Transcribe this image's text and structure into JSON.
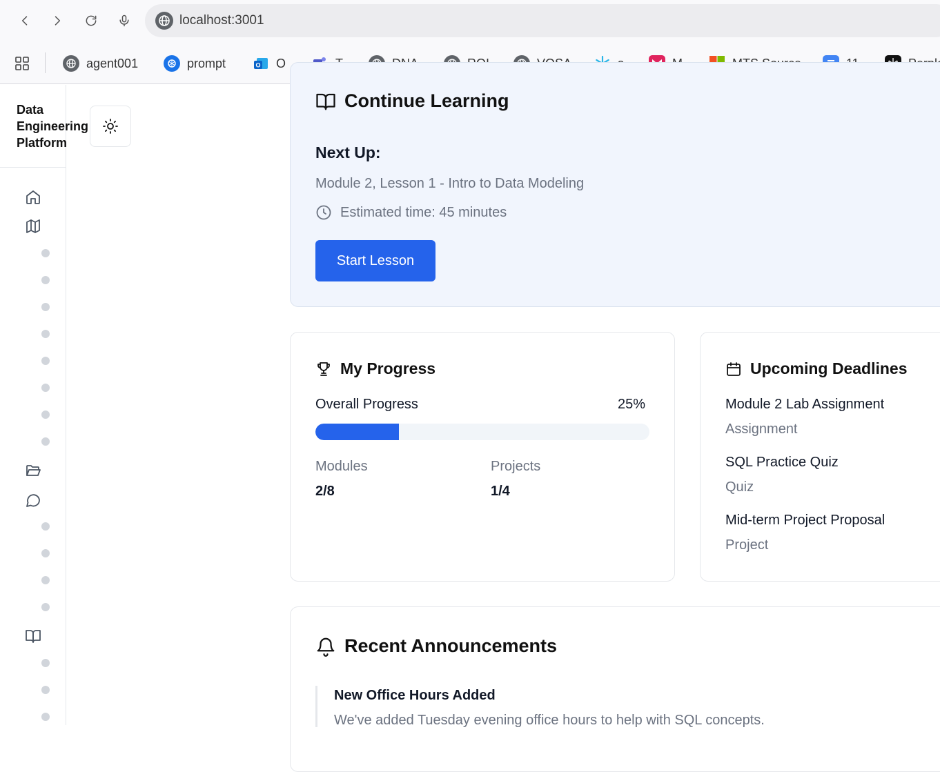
{
  "browser": {
    "url": "localhost:3001",
    "bookmarks": [
      {
        "label": "agent001",
        "icon": "globe-icon"
      },
      {
        "label": "prompt",
        "icon": "openai-icon"
      },
      {
        "label": "O",
        "icon": "outlook-icon"
      },
      {
        "label": "T",
        "icon": "teams-icon"
      },
      {
        "label": "DNA",
        "icon": "globe-icon"
      },
      {
        "label": "ROI",
        "icon": "globe-icon"
      },
      {
        "label": "VOSA",
        "icon": "globe-icon"
      },
      {
        "label": "s",
        "icon": "snowflake-icon"
      },
      {
        "label": "M",
        "icon": "m-logo-icon"
      },
      {
        "label": "MTS Source",
        "icon": "microsoft-icon"
      },
      {
        "label": "11",
        "icon": "docs-icon"
      },
      {
        "label": "Perple",
        "icon": "perplexity-icon"
      }
    ]
  },
  "sidebar": {
    "brand": "Data Engineering Platform"
  },
  "continue_learning": {
    "title": "Continue Learning",
    "next_up_label": "Next Up:",
    "lesson": "Module 2, Lesson 1 - Intro to Data Modeling",
    "estimated": "Estimated time: 45 minutes",
    "button": "Start Lesson"
  },
  "progress": {
    "title": "My Progress",
    "overall_label": "Overall Progress",
    "overall_value": "25%",
    "overall_fraction": 0.25,
    "modules_label": "Modules",
    "modules_value": "2/8",
    "projects_label": "Projects",
    "projects_value": "1/4"
  },
  "deadlines": {
    "title": "Upcoming Deadlines",
    "items": [
      {
        "name": "Module 2 Lab Assignment",
        "type": "Assignment"
      },
      {
        "name": "SQL Practice Quiz",
        "type": "Quiz"
      },
      {
        "name": "Mid-term Project Proposal",
        "type": "Project"
      }
    ]
  },
  "announcements": {
    "title": "Recent Announcements",
    "items": [
      {
        "title": "New Office Hours Added",
        "body": "We've added Tuesday evening office hours to help with SQL concepts."
      }
    ]
  },
  "colors": {
    "accent": "#2563eb",
    "card_highlight": "#f1f5fd",
    "muted_text": "#6b7280"
  }
}
